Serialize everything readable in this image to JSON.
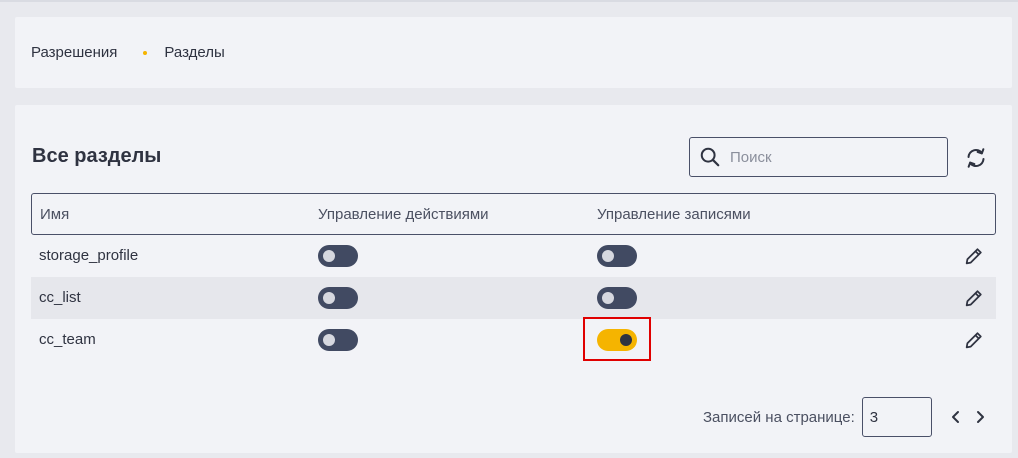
{
  "breadcrumb": {
    "items": [
      "Разрешения",
      "Разделы"
    ]
  },
  "page": {
    "title": "Все разделы"
  },
  "search": {
    "placeholder": "Поиск",
    "value": ""
  },
  "table": {
    "headers": [
      "Имя",
      "Управление действиями",
      "Управление записями"
    ],
    "rows": [
      {
        "name": "storage_profile",
        "actions_enabled": false,
        "records_enabled": false
      },
      {
        "name": "cc_list",
        "actions_enabled": false,
        "records_enabled": false
      },
      {
        "name": "cc_team",
        "actions_enabled": false,
        "records_enabled": true
      }
    ]
  },
  "pagination": {
    "label": "Записей на странице:",
    "per_page": "3"
  },
  "colors": {
    "accent": "#f5b400",
    "toggle_off": "#414a62",
    "highlight": "#e00000",
    "text": "#2f3341"
  },
  "icons": [
    "search-icon",
    "refresh-icon",
    "pencil-icon",
    "chevron-left-icon",
    "chevron-right-icon"
  ]
}
